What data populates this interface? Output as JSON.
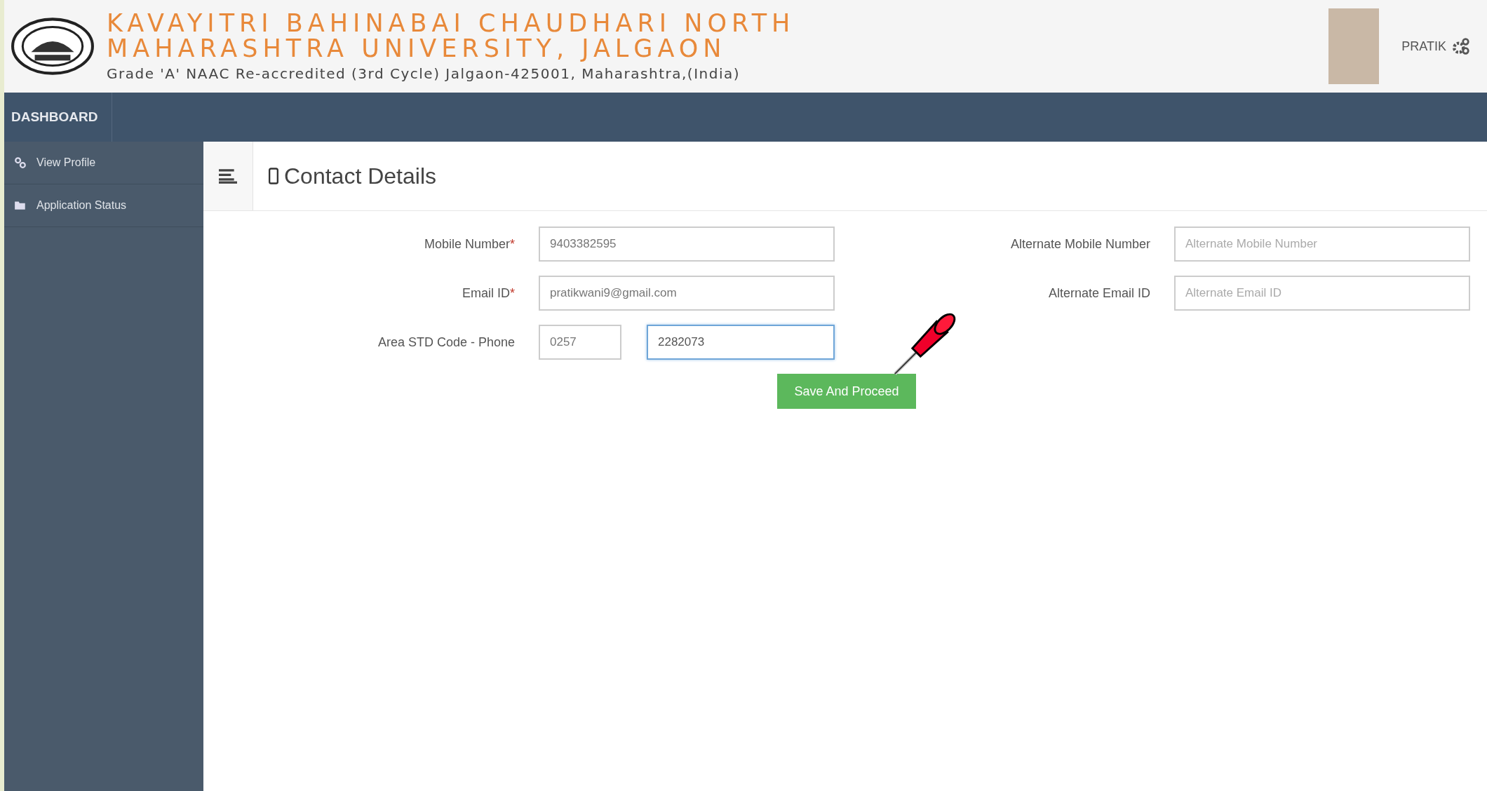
{
  "header": {
    "title_lines": [
      "KAVAYITRI BAHINABAI CHAUDHARI NORTH",
      "MAHARASHTRA UNIVERSITY, JALGAON"
    ],
    "subtitle": "Grade 'A' NAAC Re-accredited (3rd Cycle) Jalgaon-425001, Maharashtra,(India)",
    "user_name": "PRATIK"
  },
  "navbar": {
    "brand": "DASHBOARD"
  },
  "sidebar": {
    "items": [
      {
        "label": "View Profile",
        "kind": "link"
      },
      {
        "label": "Application Status",
        "kind": "folder"
      }
    ]
  },
  "page": {
    "title": "Contact Details"
  },
  "form": {
    "left": [
      {
        "label": "Mobile Number",
        "required_mark": "*",
        "inputs": [
          {
            "value": "9403382595",
            "focused": false,
            "kind": "wide"
          }
        ]
      },
      {
        "label": "Email ID",
        "required_mark": "*",
        "inputs": [
          {
            "value": "pratikwani9@gmail.com",
            "focused": false,
            "kind": "wide"
          }
        ]
      },
      {
        "label": "Area STD Code - Phone",
        "inputs": [
          {
            "value": "0257",
            "focused": false,
            "kind": "short"
          },
          {
            "value": "2282073",
            "focused": true,
            "kind": "medium"
          }
        ]
      }
    ],
    "right": [
      {
        "label": "Alternate Mobile Number",
        "placeholder": "Alternate Mobile Number"
      },
      {
        "label": "Alternate Email ID",
        "placeholder": "Alternate Email ID"
      }
    ],
    "submit": "Save And Proceed"
  }
}
